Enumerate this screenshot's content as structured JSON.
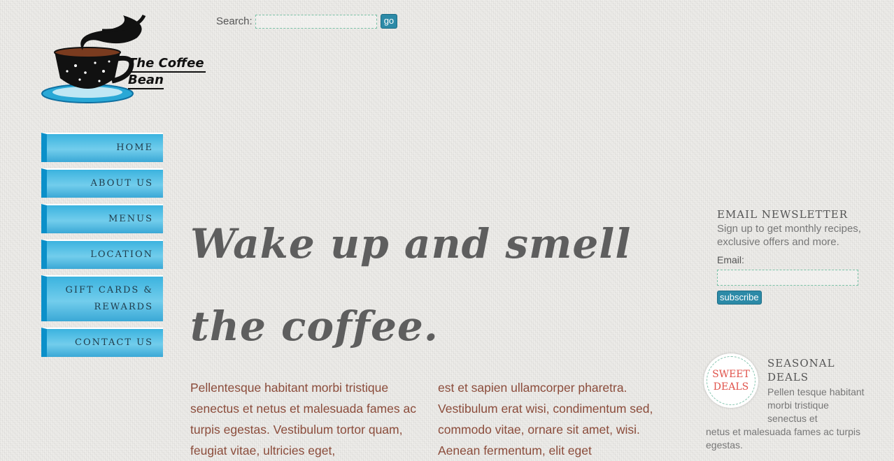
{
  "logo": {
    "line1": "The Coffee",
    "line2": "Bean"
  },
  "search": {
    "label": "Search:",
    "go_label": "go"
  },
  "nav": [
    "HOME",
    "ABOUT US",
    "MENUS",
    "LOCATION",
    "GIFT CARDS & REWARDS",
    "CONTACT US"
  ],
  "hero": {
    "title": "Wake up and smell the coffee."
  },
  "body": {
    "col1": "Pellentesque habitant morbi tristique senectus et netus et malesuada fames ac turpis egestas. Vestibulum tortor quam, feugiat vitae, ultricies eget,",
    "col2": "est et sapien ullamcorper pharetra. Vestibulum erat wisi, condimentum sed, commodo vitae, ornare sit amet, wisi. Aenean fermentum, elit eget"
  },
  "newsletter": {
    "title": "EMAIL NEWSLETTER",
    "text": "Sign up to get monthly recipes, exclusive offers and more.",
    "email_label": "Email:",
    "subscribe_label": "subscribe"
  },
  "deals": {
    "badge": "SWEET DEALS",
    "title": "SEASONAL DEALS",
    "text1": "Pellen tesque habitant morbi tristique senectus et",
    "text2": "netus et malesuada fames ac turpis egestas."
  },
  "colors": {
    "accent": "#2c8aa7",
    "nav": "#3bb3df",
    "body_text": "#8b4c3b",
    "deals_red": "#e0524a"
  }
}
